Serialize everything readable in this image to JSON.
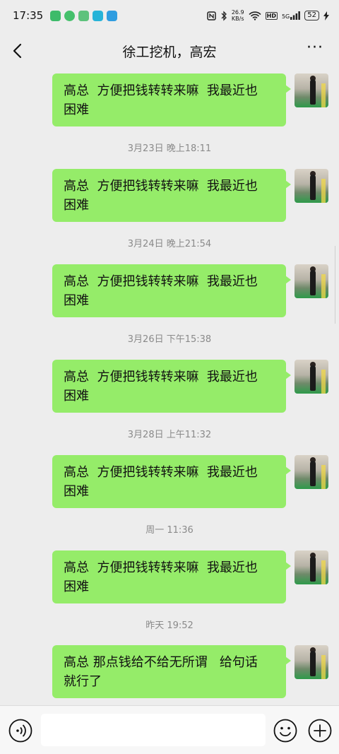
{
  "status_bar": {
    "time": "17:35",
    "net_speed_value": "26.9",
    "net_speed_unit": "KB/s",
    "hd": "HD",
    "signal": "5G",
    "battery": "52",
    "notif_colors": [
      "#3dbb6a",
      "#44c06b",
      "#5ec27c",
      "#27b3d8",
      "#2f9de0"
    ]
  },
  "nav": {
    "title": "徐工挖机，高宏",
    "back_icon": "chevron-left-icon",
    "more_icon": "more-dots-icon",
    "more_glyph": "···"
  },
  "chat": {
    "bubble_color": "#95ec69",
    "messages": [
      {
        "text": "高总  方便把钱转转来嘛  我最近也\n困难"
      },
      {
        "timestamp": "3月23日 晚上18:11",
        "text": "高总  方便把钱转转来嘛  我最近也\n困难"
      },
      {
        "timestamp": "3月24日 晚上21:54",
        "text": "高总  方便把钱转转来嘛  我最近也\n困难"
      },
      {
        "timestamp": "3月26日 下午15:38",
        "text": "高总  方便把钱转转来嘛  我最近也\n困难"
      },
      {
        "timestamp": "3月28日 上午11:32",
        "text": "高总  方便把钱转转来嘛  我最近也\n困难"
      },
      {
        "timestamp": "周一 11:36",
        "text": "高总  方便把钱转转来嘛  我最近也\n困难"
      },
      {
        "timestamp": "昨天 19:52",
        "text": "高总 那点钱给不给无所谓   给句话\n就行了"
      }
    ]
  },
  "input_bar": {
    "voice_icon": "voice-icon",
    "emoji_icon": "emoji-icon",
    "plus_icon": "plus-icon",
    "placeholder": ""
  }
}
